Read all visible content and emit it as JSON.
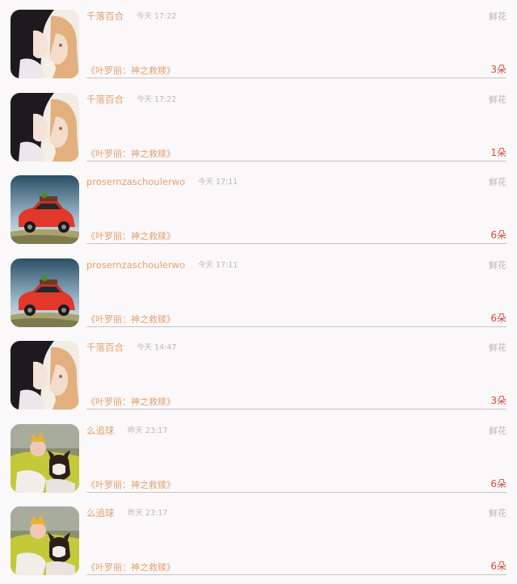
{
  "gift_label": "鲜花",
  "book_title": "《叶罗丽：神之救赎》",
  "records": [
    {
      "user": "千落百合",
      "time": "今天 17:22",
      "count": "3朵",
      "avatar": "anime-icon"
    },
    {
      "user": "千落百合",
      "time": "今天 17:22",
      "count": "1朵",
      "avatar": "anime-icon"
    },
    {
      "user": "prosernzaschoulerwo",
      "time": "今天 17:11",
      "count": "6朵",
      "avatar": "car-icon"
    },
    {
      "user": "prosernzaschoulerwo",
      "time": "今天 17:11",
      "count": "6朵",
      "avatar": "car-icon"
    },
    {
      "user": "千落百合",
      "time": "今天 14:47",
      "count": "3朵",
      "avatar": "anime-icon"
    },
    {
      "user": "么追球",
      "time": "昨天 23:17",
      "count": "6朵",
      "avatar": "baby-dog-icon"
    },
    {
      "user": "么追球",
      "time": "昨天 23:17",
      "count": "6朵",
      "avatar": "baby-dog-icon"
    }
  ],
  "colors": {
    "background": "#fbf8f9",
    "username": "#e0a16f",
    "count": "#cf4b3f",
    "muted": "#b9b3b3"
  }
}
